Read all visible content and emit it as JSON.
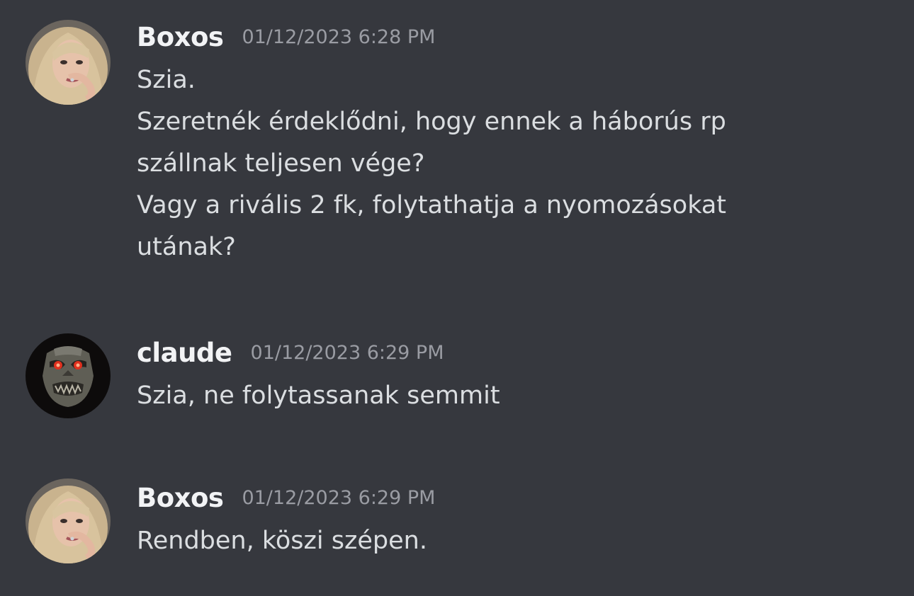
{
  "messages": [
    {
      "author": "Boxos",
      "timestamp": "01/12/2023 6:28 PM",
      "lines": [
        "Szia.",
        "Szeretnék érdeklődni, hogy ennek a háborús rp",
        "szállnak teljesen vége?",
        "Vagy a rivális 2 fk, folytathatja a nyomozásokat",
        "utának?"
      ]
    },
    {
      "author": "claude",
      "timestamp": "01/12/2023 6:29 PM",
      "lines": [
        "Szia, ne folytassanak semmit"
      ]
    },
    {
      "author": "Boxos",
      "timestamp": "01/12/2023 6:29 PM",
      "lines": [
        "Rendben, köszi szépen."
      ]
    }
  ],
  "colors": {
    "background": "#36383e",
    "username": "#f2f3f5",
    "timestamp": "#9a9ca3",
    "text": "#dbdee1"
  }
}
